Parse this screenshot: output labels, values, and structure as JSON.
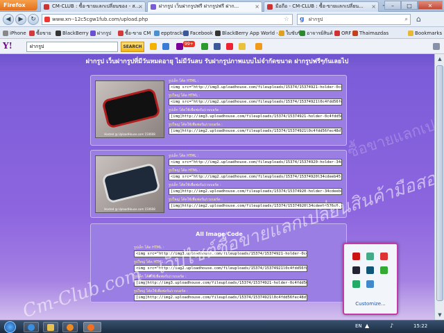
{
  "browser": {
    "menu_label": "Firefox",
    "tabs": [
      {
        "label": "CM-CLUB : ซื้อ-ขายแลกเปลี่ยนของ - ส...",
        "active": false
      },
      {
        "label": "ฝากรูป เว็บฝากรูปฟรี ฝากรูปฟรี ฝาก...",
        "active": true
      },
      {
        "label": "มือถือ - CM-CLUB : ซื้อ-ขายแลกเปลี่ยน...",
        "active": false
      }
    ],
    "new_tab": "+",
    "url": "www.xn--12c5cgw1fub.com/upload.php",
    "search_placeholder": "ฝากรูป",
    "search_logo": "g"
  },
  "bookmarks": [
    {
      "label": "iPhone",
      "color": "#888888"
    },
    {
      "label": "ซื้อขาย",
      "color": "#d23b3b"
    },
    {
      "label": "BlackBerry",
      "color": "#333333"
    },
    {
      "label": "ฝากรูป",
      "color": "#6a4fd0"
    },
    {
      "label": "ซื้อ-ขาย CM",
      "color": "#d23b3b"
    },
    {
      "label": "epptrackr",
      "color": "#4a90d0"
    },
    {
      "label": "Facebook",
      "color": "#3b5998"
    },
    {
      "label": "BlackBerry App World -...",
      "color": "#333333"
    },
    {
      "label": "ใบขับขี่",
      "color": "#e0a020"
    },
    {
      "label": "อาจารย์สินค้",
      "color": "#2a8a2a"
    },
    {
      "label": "ORF",
      "color": "#d03030"
    },
    {
      "label": "Thaimazdas",
      "color": "#c04020"
    },
    {
      "label": "Bookmarks",
      "color": "#e8b830"
    }
  ],
  "yahoo_toolbar": {
    "logo": "Y!",
    "search_value": "ฝากรูป",
    "search_button": "SEARCH",
    "badge": "99+"
  },
  "page": {
    "banner": "ฝากรูป เว็บฝากรูปที่มีวันหมดอายุ ไม่มีวันลบ รับฝากรูปภาพแบบไม่จำกัดขนาด ฝากรูปฟรีๆกันเลยไป",
    "images": [
      {
        "caption": "Hosted @ UploadHouse.com 150608",
        "codes": [
          {
            "label": "รูปเล็ก โค้ด HTML :",
            "value": "<img src=\"http://img3.uploadhouse.com/fileuploads/15374/15374921-holder-0c4fd56..."
          },
          {
            "label": "รูปใหญ่ โค้ด HTML :",
            "value": "<img src=\"http://img2.uploadhouse.com/fileuploads/15374/15374921l0c4fdd56fec..."
          },
          {
            "label": "รูปเล็ก โค้ดใช้เพื่อฟอรั่ม/เวบบอร์ด :",
            "value": "[img]http://img3.uploadhouse.com/fileuploads/15374/15374921-holder-0c4fdd56fe..."
          },
          {
            "label": "รูปใหญ่ โค้ดใช้เพื่อฟอรั่ม/เวบบอร์ด :",
            "value": "[img]http://img2.uploadhouse.com/fileuploads/15374/15374921l0c4fdd56fec48d7..."
          }
        ]
      },
      {
        "caption": "Hosted @ UploadHouse.com 150608",
        "codes": [
          {
            "label": "รูปเล็ก โค้ด HTML :",
            "value": "<img src=\"http://img2.uploadhouse.com/fileuploads/15374/15374920-holder-34cd..."
          },
          {
            "label": "รูปใหญ่ โค้ด HTML :",
            "value": "<img src=\"http://img2.uploadhouse.com/fileuploads/15374/15374920l34cdeeb45..."
          },
          {
            "label": "รูปเล็ก โค้ดใช้เพื่อฟอรั่ม/เวบบอร์ด :",
            "value": "[img]http://img2.uploadhouse.com/fileuploads/15374/15374920-holder-34cdeeb4..."
          },
          {
            "label": "รูปใหญ่ โค้ดใช้เพื่อฟอรั่ม/เวบบอร์ด :",
            "value": "[img]http://img2.uploadhouse.com/fileuploads/15374/15374920l34cdeeb4576c6..."
          }
        ]
      }
    ],
    "all_heading": "All Image Code",
    "all_codes": [
      {
        "label": "รูปเล็ก โค้ด HTML :",
        "value": "<img src=\"http://img3.uploadhouse.com/fileuploads/15374/15374921-holder-0c4fd..."
      },
      {
        "label": "รูปใหญ่ โค้ด HTML :",
        "value": "<img src=\"http://img2.uploadhouse.com/fileuploads/15374/15374921l0c4fdd56fec..."
      },
      {
        "label": "รูปเล็ก โค้ดใช้เพื่อฟอรั่ม/เวบบอร์ด :",
        "value": "[img]http://img3.uploadhouse.com/fileuploads/15374/15374921-holder-0c4fdd56fe..."
      },
      {
        "label": "รูปใหญ่ โค้ดใช้เพื่อฟอรั่ม/เวบบอร์ด :",
        "value": "[img]http://img2.uploadhouse.com/fileuploads/15374/15374921l0c4fdd56fec48d7..."
      }
    ],
    "watermark": "Cm-Club.com : เว็บไซต์ซื้อขายแลกเปลี่ยนสินค้ามือสองภาคเหนือ",
    "watermark2": "Cm-Club.com : ซื้อขายแลกเปลี่ยนภาคเหนือ"
  },
  "tray": {
    "customize": "Customize...",
    "language": "EN",
    "clock": "15:22"
  }
}
